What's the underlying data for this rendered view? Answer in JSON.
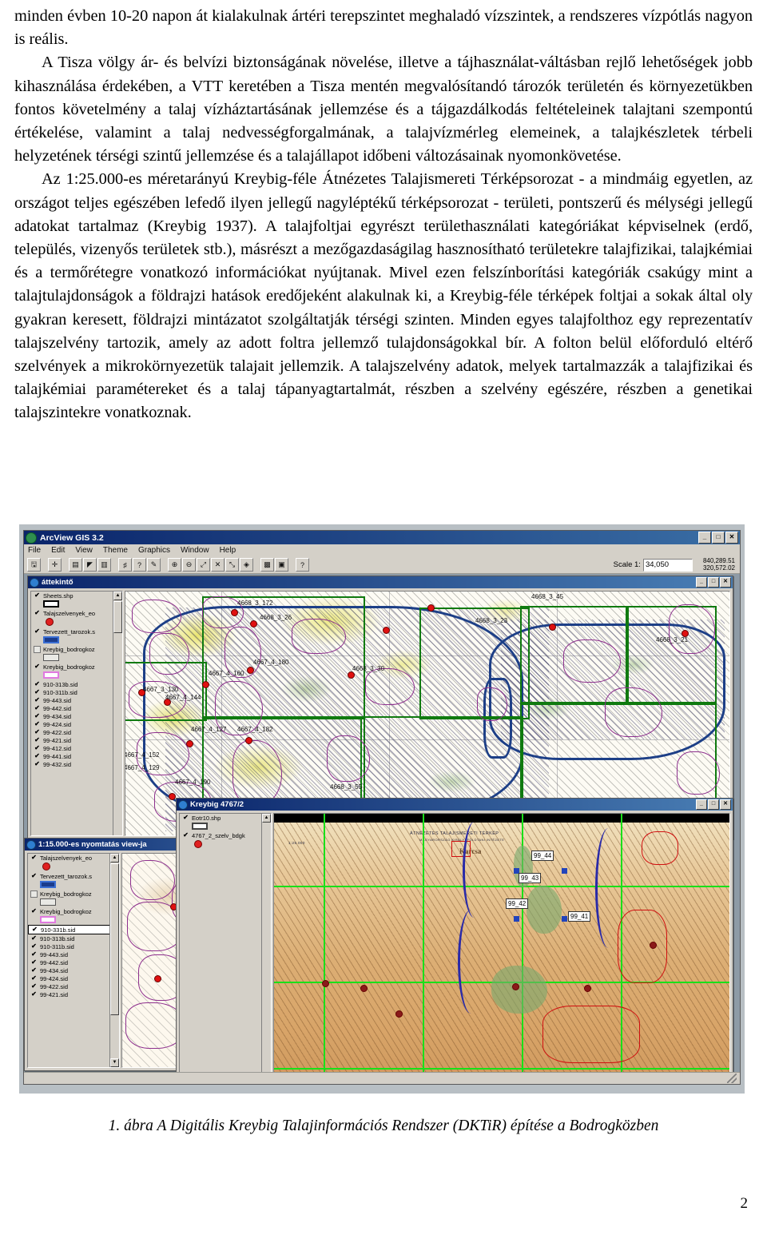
{
  "document": {
    "paragraphs": [
      "minden évben 10-20 napon át kialakulnak ártéri terepszintet meghaladó vízszintek, a rendszeres vízpótlás nagyon is reális.",
      "A Tisza völgy ár- és belvízi biztonságának növelése, illetve a tájhasználat-váltásban rejlő lehetőségek jobb kihasználása érdekében, a VTT keretében a Tisza mentén megvalósítandó tározók területén és környezetükben fontos követelmény a talaj vízháztartásának jellemzése és a tájgazdálkodás feltételeinek talajtani szempontú értékelése, valamint a talaj nedvességforgalmának, a talajvízmérleg elemeinek, a talajkészletek térbeli helyzetének térségi szintű jellemzése és a talajállapot időbeni változásainak nyomonkövetése.",
      "Az 1:25.000-es méretarányú Kreybig-féle Átnézetes Talajismereti Térképsorozat - a mindmáig egyetlen, az országot teljes egészében lefedő ilyen jellegű nagyléptékű térképsorozat - területi, pontszerű és mélységi jellegű adatokat tartalmaz (Kreybig 1937). A talajfoltjai egyrészt területhasználati kategóriákat képviselnek (erdő, település, vizenyős területek stb.), másrészt a mezőgazdaságilag hasznosítható területekre talajfizikai, talajkémiai és a termőrétegre vonatkozó információkat nyújtanak. Mivel ezen felszínborítási kategóriák csakúgy mint a talajtulajdonságok a földrajzi hatások eredőjeként alakulnak ki, a Kreybig-féle térképek foltjai a sokak által oly gyakran keresett, földrajzi mintázatot szolgáltatják térségi szinten. Minden egyes talajfolthoz egy reprezentatív talajszelvény tartozik, amely az adott foltra jellemző tulajdonságokkal bír. A folton belül előforduló eltérő szelvények a mikrokörnyezetük talajait jellemzik. A talajszelvény adatok, melyek tartalmazzák a talajfizikai és talajkémiai paramétereket és a talaj tápanyagtartalmát, részben a szelvény egészére, részben a genetikai talajszintekre vonatkoznak."
    ],
    "figure_caption": "1. ábra A Digitális Kreybig Talajinformációs Rendszer (DKTiR) építése a Bodrogközben",
    "page_number": "2"
  },
  "gis": {
    "window_title": "ArcView GIS 3.2",
    "title_icon": "arcview-globe-icon",
    "window_buttons": [
      "_",
      "□",
      "✕"
    ],
    "menu": [
      "File",
      "Edit",
      "View",
      "Theme",
      "Graphics",
      "Window",
      "Help"
    ],
    "toolbar_row1": [
      "save-icon",
      "add-theme-icon",
      "theme-properties-icon",
      "edit-legend-icon",
      "open-table-icon",
      "query-builder-icon",
      "find-icon",
      "locate-address-icon",
      "zoom-in-extent-icon",
      "zoom-out-extent-icon",
      "zoom-selected-icon",
      "zoom-previous-icon",
      "zoom-full-extent-icon",
      "select-feature-icon",
      "clear-selection-icon",
      "layout-icon",
      "help-pointer-icon"
    ],
    "toolbar_row2": [
      "identify-icon",
      "pointer-icon",
      "vertex-edit-icon",
      "select-box-icon",
      "zoom-in-icon",
      "zoom-out-icon",
      "pan-icon",
      "measure-icon",
      "hotlink-icon",
      "label-icon",
      "draw-point-icon",
      "text-icon",
      "draw-shape-icon"
    ],
    "scale": {
      "label": "Scale 1:",
      "value": "34,050"
    },
    "coordinates": {
      "x": "840,289.51",
      "y": "320,572.02"
    },
    "windows": [
      {
        "title": "áttekintő",
        "state": "active",
        "buttons": [
          "_",
          "□",
          "✕"
        ],
        "layers": [
          {
            "name": "Sheets.shp",
            "checked": true,
            "symbol": "hollow-rect"
          },
          {
            "name": "Talajszelvenyek_eo",
            "checked": true,
            "symbol": "red-dot"
          },
          {
            "name": "Tervezett_tarozok.s",
            "checked": true,
            "symbol": "blue-rect"
          },
          {
            "name": "Kreybig_bodrogkoz",
            "checked": false,
            "symbol": "gray-rect"
          },
          {
            "name": "Kreybig_bodrogkoz",
            "checked": true,
            "symbol": "pink-rect"
          },
          {
            "name": "910-313b.sid",
            "checked": true,
            "symbol": "none"
          },
          {
            "name": "910-311b.sid",
            "checked": true,
            "symbol": "none"
          },
          {
            "name": "99-443.sid",
            "checked": true,
            "symbol": "none"
          },
          {
            "name": "99-442.sid",
            "checked": true,
            "symbol": "none"
          },
          {
            "name": "99-434.sid",
            "checked": true,
            "symbol": "none"
          },
          {
            "name": "99-424.sid",
            "checked": true,
            "symbol": "none"
          },
          {
            "name": "99-422.sid",
            "checked": true,
            "symbol": "none"
          },
          {
            "name": "99-421.sid",
            "checked": true,
            "symbol": "none"
          },
          {
            "name": "99-412.sid",
            "checked": true,
            "symbol": "none"
          },
          {
            "name": "99-441.sid",
            "checked": true,
            "symbol": "none"
          },
          {
            "name": "99-432.sid",
            "checked": true,
            "symbol": "none"
          }
        ],
        "map_labels": [
          "4668_3_45",
          "4668_3_26",
          "4668_3_23",
          "4668_3_21",
          "4668_3_172",
          "4667_4_180",
          "4667_4_160",
          "4668_3_30",
          "4667_3_130",
          "4667_4_144",
          "4667_4_127",
          "4667_4_182",
          "4667_4_152",
          "4667_4_129",
          "4667_4_190",
          "4668_3_55",
          "4668_3_5"
        ]
      },
      {
        "title": "1:15.000-es nyomtatás view-ja",
        "state": "active",
        "buttons": [
          "_",
          "□",
          "✕"
        ],
        "layers": [
          {
            "name": "Talajszelvenyek_eo",
            "checked": true,
            "symbol": "red-dot"
          },
          {
            "name": "Tervezett_tarozok.s",
            "checked": true,
            "symbol": "blue-rect"
          },
          {
            "name": "Kreybig_bodrogkoz",
            "checked": false,
            "symbol": "gray-rect"
          },
          {
            "name": "Kreybig_bodrogkoz",
            "checked": true,
            "symbol": "pink-rect"
          },
          {
            "name": "910-331b.sid",
            "checked": true,
            "symbol": "none",
            "selected": true
          },
          {
            "name": "910-313b.sid",
            "checked": true,
            "symbol": "none"
          },
          {
            "name": "910-311b.sid",
            "checked": true,
            "symbol": "none"
          },
          {
            "name": "99-443.sid",
            "checked": true,
            "symbol": "none"
          },
          {
            "name": "99-442.sid",
            "checked": true,
            "symbol": "none"
          },
          {
            "name": "99-434.sid",
            "checked": true,
            "symbol": "none"
          },
          {
            "name": "99-424.sid",
            "checked": true,
            "symbol": "none"
          },
          {
            "name": "99-422.sid",
            "checked": true,
            "symbol": "none"
          },
          {
            "name": "99-421.sid",
            "checked": true,
            "symbol": "none"
          }
        ]
      },
      {
        "title": "Kreybig 4767/2",
        "state": "active",
        "buttons": [
          "_",
          "□",
          "✕"
        ],
        "layers": [
          {
            "name": "Eotr10.shp",
            "checked": true,
            "symbol": "none"
          },
          {
            "name": "4767_2_szelv_bdgk",
            "checked": true,
            "symbol": "none"
          }
        ],
        "map_title": "ÁTNÉZETES TALAJISMERETI TÉRKÉP",
        "map_subtitle": "MAGYARORSZÁG KIRÁLYI FÖLDTANI INTÉZETE",
        "place_label": "Karcsa",
        "sheet_labels": [
          "99_44",
          "99_43",
          "99_42",
          "99_41"
        ]
      }
    ]
  }
}
